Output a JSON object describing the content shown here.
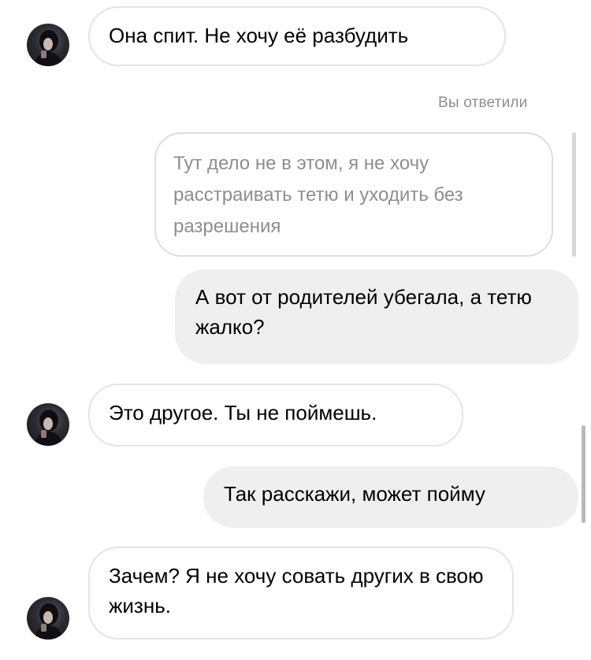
{
  "thread": {
    "messages": [
      {
        "direction": "incoming",
        "text": "Она спит. Не хочу её разбудить"
      },
      {
        "direction": "outgoing",
        "reply_label": "Вы ответили",
        "quoted_text": "Тут дело не в этом, я не хочу расстраивать тетю и уходить без разрешения"
      },
      {
        "direction": "outgoing",
        "text": "А вот от родителей убегала, а тетю жалко?"
      },
      {
        "direction": "incoming",
        "text": "Это другое. Ты не поймешь."
      },
      {
        "direction": "outgoing",
        "text": "Так расскажи, может пойму"
      },
      {
        "direction": "incoming",
        "text": "Зачем? Я не хочу совать других в свою жизнь."
      }
    ]
  },
  "colors": {
    "incoming_bubble_border": "#e4e4e6",
    "outgoing_bubble_fill": "#efefef",
    "secondary_text": "#8e8e8e"
  }
}
